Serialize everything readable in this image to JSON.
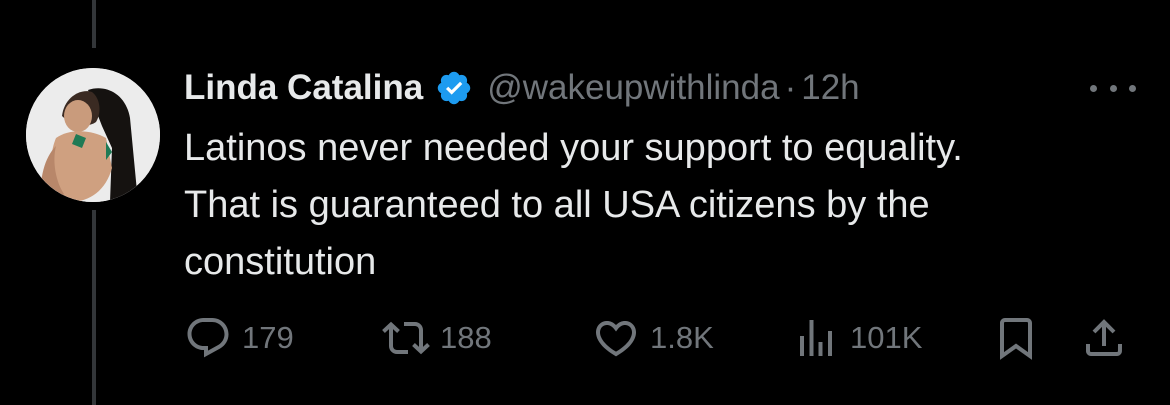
{
  "tweet": {
    "author_name": "Linda Catalina",
    "handle": "@wakeupwithlinda",
    "separator": "·",
    "time": "12h",
    "text_lines": [
      "Latinos never needed your support to equality.",
      "That is guaranteed to all USA citizens by the",
      "constitution"
    ]
  },
  "actions": {
    "replies": "179",
    "reposts": "188",
    "likes": "1.8K",
    "views": "101K"
  },
  "colors": {
    "background": "#000000",
    "primary_text": "#e7e9ea",
    "secondary_text": "#71767b",
    "verified_badge": "#1d9bf0",
    "thread_line": "#333639"
  },
  "icons": {
    "verified": "verified-badge-icon",
    "more": "more-icon",
    "reply": "reply-icon",
    "repost": "repost-icon",
    "like": "heart-icon",
    "views": "views-icon",
    "bookmark": "bookmark-icon",
    "share": "share-icon"
  }
}
